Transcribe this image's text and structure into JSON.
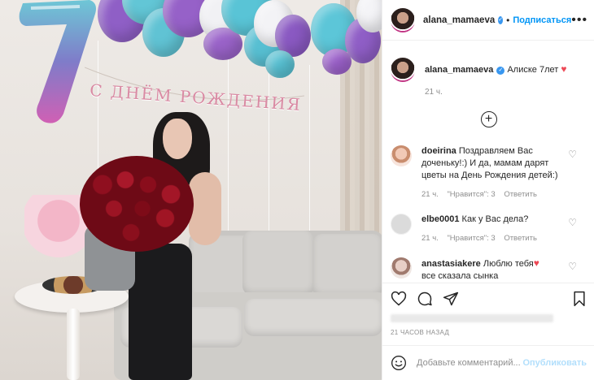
{
  "photo": {
    "banner_text": "С ДНЁМ РОЖДЕНИЯ"
  },
  "header": {
    "username": "alana_mamaeva",
    "separator": "•",
    "follow_label": "Подписаться",
    "more_label": "•••"
  },
  "caption": {
    "username": "alana_mamaeva",
    "text": "Алиске 7лет",
    "time": "21 ч."
  },
  "comments": [
    {
      "username": "doeirina",
      "text": "Поздравляем Вас доченьку!:) И да, мамам дарят цветы на День Рождения детей:)",
      "time": "21 ч.",
      "likes": "\"Нравится\": 3",
      "reply": "Ответить"
    },
    {
      "username": "elbe0001",
      "text": "Как у Вас дела?",
      "time": "21 ч.",
      "likes": "\"Нравится\": 3",
      "reply": "Ответить"
    },
    {
      "username": "anastasiakere",
      "text": "Люблю тебя",
      "text_line2": "все сказала сынка"
    }
  ],
  "post": {
    "time": "21 ЧАСОВ НАЗАД"
  },
  "add_comment": {
    "placeholder": "Добавьте комментарий...",
    "publish_label": "Опубликовать"
  },
  "colors": {
    "accent": "#0095f6",
    "publish_disabled": "#b2dffc",
    "heart": "#ed4956",
    "muted": "#8e8e8e"
  }
}
